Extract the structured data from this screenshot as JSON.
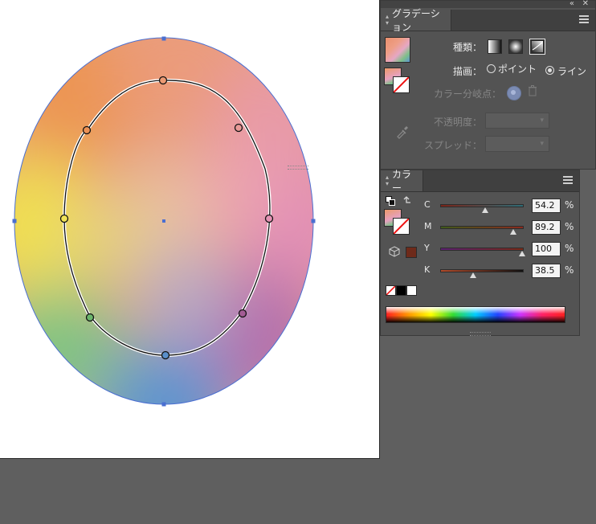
{
  "gradient_panel": {
    "tab_label": "グラデーション",
    "type_label": "種類：",
    "draw_label": "描画：",
    "draw_option_point": "ポイント",
    "draw_option_line": "ライン",
    "draw_selected": "line",
    "color_stop_label": "カラー分岐点：",
    "opacity_label": "不透明度：",
    "spread_label": "スプレッド：",
    "type_icons": [
      "linear-gradient-icon",
      "radial-gradient-icon",
      "freeform-gradient-icon"
    ]
  },
  "color_panel": {
    "tab_label": "カラー",
    "channels": [
      {
        "label": "C",
        "value": "54.2",
        "level": 0.542
      },
      {
        "label": "M",
        "value": "89.2",
        "level": 0.892
      },
      {
        "label": "Y",
        "value": "100",
        "level": 1.0
      },
      {
        "label": "K",
        "value": "38.5",
        "level": 0.385
      }
    ],
    "unit": "%",
    "fill_color": "#6e2a1a"
  },
  "colors": {
    "panel_bg": "#535353",
    "canvas_bg": "#5f5f5f",
    "selection_blue": "#4a6fd1"
  },
  "icons": {
    "collapse": "double-chevron-left-icon",
    "close": "close-icon",
    "menu": "panel-menu-icon",
    "eyedropper": "eyedropper-icon",
    "trash": "trash-icon",
    "swap": "swap-arrow-icon",
    "cube": "out-of-gamut-cube-icon"
  }
}
